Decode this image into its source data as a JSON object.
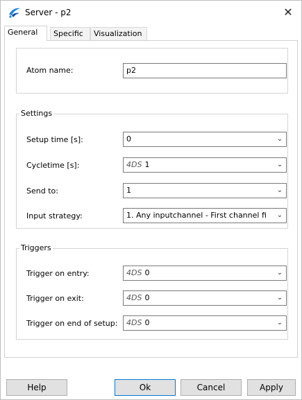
{
  "window": {
    "title": "Server - p2",
    "close_glyph": "✕"
  },
  "icons": {
    "app": "app-logo-icon",
    "close": "close-icon",
    "dropdown": "chevron-down-icon"
  },
  "tabs": [
    {
      "label": "General",
      "active": true
    },
    {
      "label": "Specific",
      "active": false
    },
    {
      "label": "Visualization",
      "active": false
    }
  ],
  "atom": {
    "label": "Atom name:",
    "value": "p2"
  },
  "settings": {
    "legend": "Settings",
    "rows": [
      {
        "label": "Setup time [s]:",
        "prefix": "",
        "value": "0"
      },
      {
        "label": "Cycletime [s]:",
        "prefix": "4DS",
        "value": "1"
      },
      {
        "label": "Send to:",
        "prefix": "",
        "value": "1"
      },
      {
        "label": "Input strategy:",
        "prefix": "",
        "value": "1. Any inputchannel -  First channel fi"
      }
    ]
  },
  "triggers": {
    "legend": "Triggers",
    "rows": [
      {
        "label": "Trigger on entry:",
        "prefix": "4DS",
        "value": "0"
      },
      {
        "label": "Trigger on exit:",
        "prefix": "4DS",
        "value": "0"
      },
      {
        "label": "Trigger on end of setup:",
        "prefix": "4DS",
        "value": "0"
      }
    ]
  },
  "buttons": {
    "help": "Help",
    "ok": "Ok",
    "cancel": "Cancel",
    "apply": "Apply"
  },
  "colors": {
    "accent": "#0078d7",
    "logo_blue": "#1e88e5",
    "logo_dark": "#0d47a1"
  }
}
